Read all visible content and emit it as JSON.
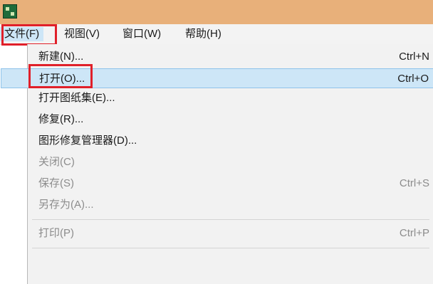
{
  "menubar": {
    "items": [
      {
        "label": "文件(F)"
      },
      {
        "label": "视图(V)"
      },
      {
        "label": "窗口(W)"
      },
      {
        "label": "帮助(H)"
      }
    ]
  },
  "file_menu": {
    "items": [
      {
        "label": "新建(N)...",
        "shortcut": "Ctrl+N"
      },
      {
        "label": "打开(O)...",
        "shortcut": "Ctrl+O"
      },
      {
        "label": "打开图纸集(E)...",
        "shortcut": ""
      },
      {
        "label": "修复(R)...",
        "shortcut": ""
      },
      {
        "label": "图形修复管理器(D)...",
        "shortcut": ""
      },
      {
        "label": "关闭(C)",
        "shortcut": ""
      },
      {
        "label": "保存(S)",
        "shortcut": "Ctrl+S"
      },
      {
        "label": "另存为(A)...",
        "shortcut": ""
      },
      {
        "label": "打印(P)",
        "shortcut": "Ctrl+P"
      }
    ]
  }
}
